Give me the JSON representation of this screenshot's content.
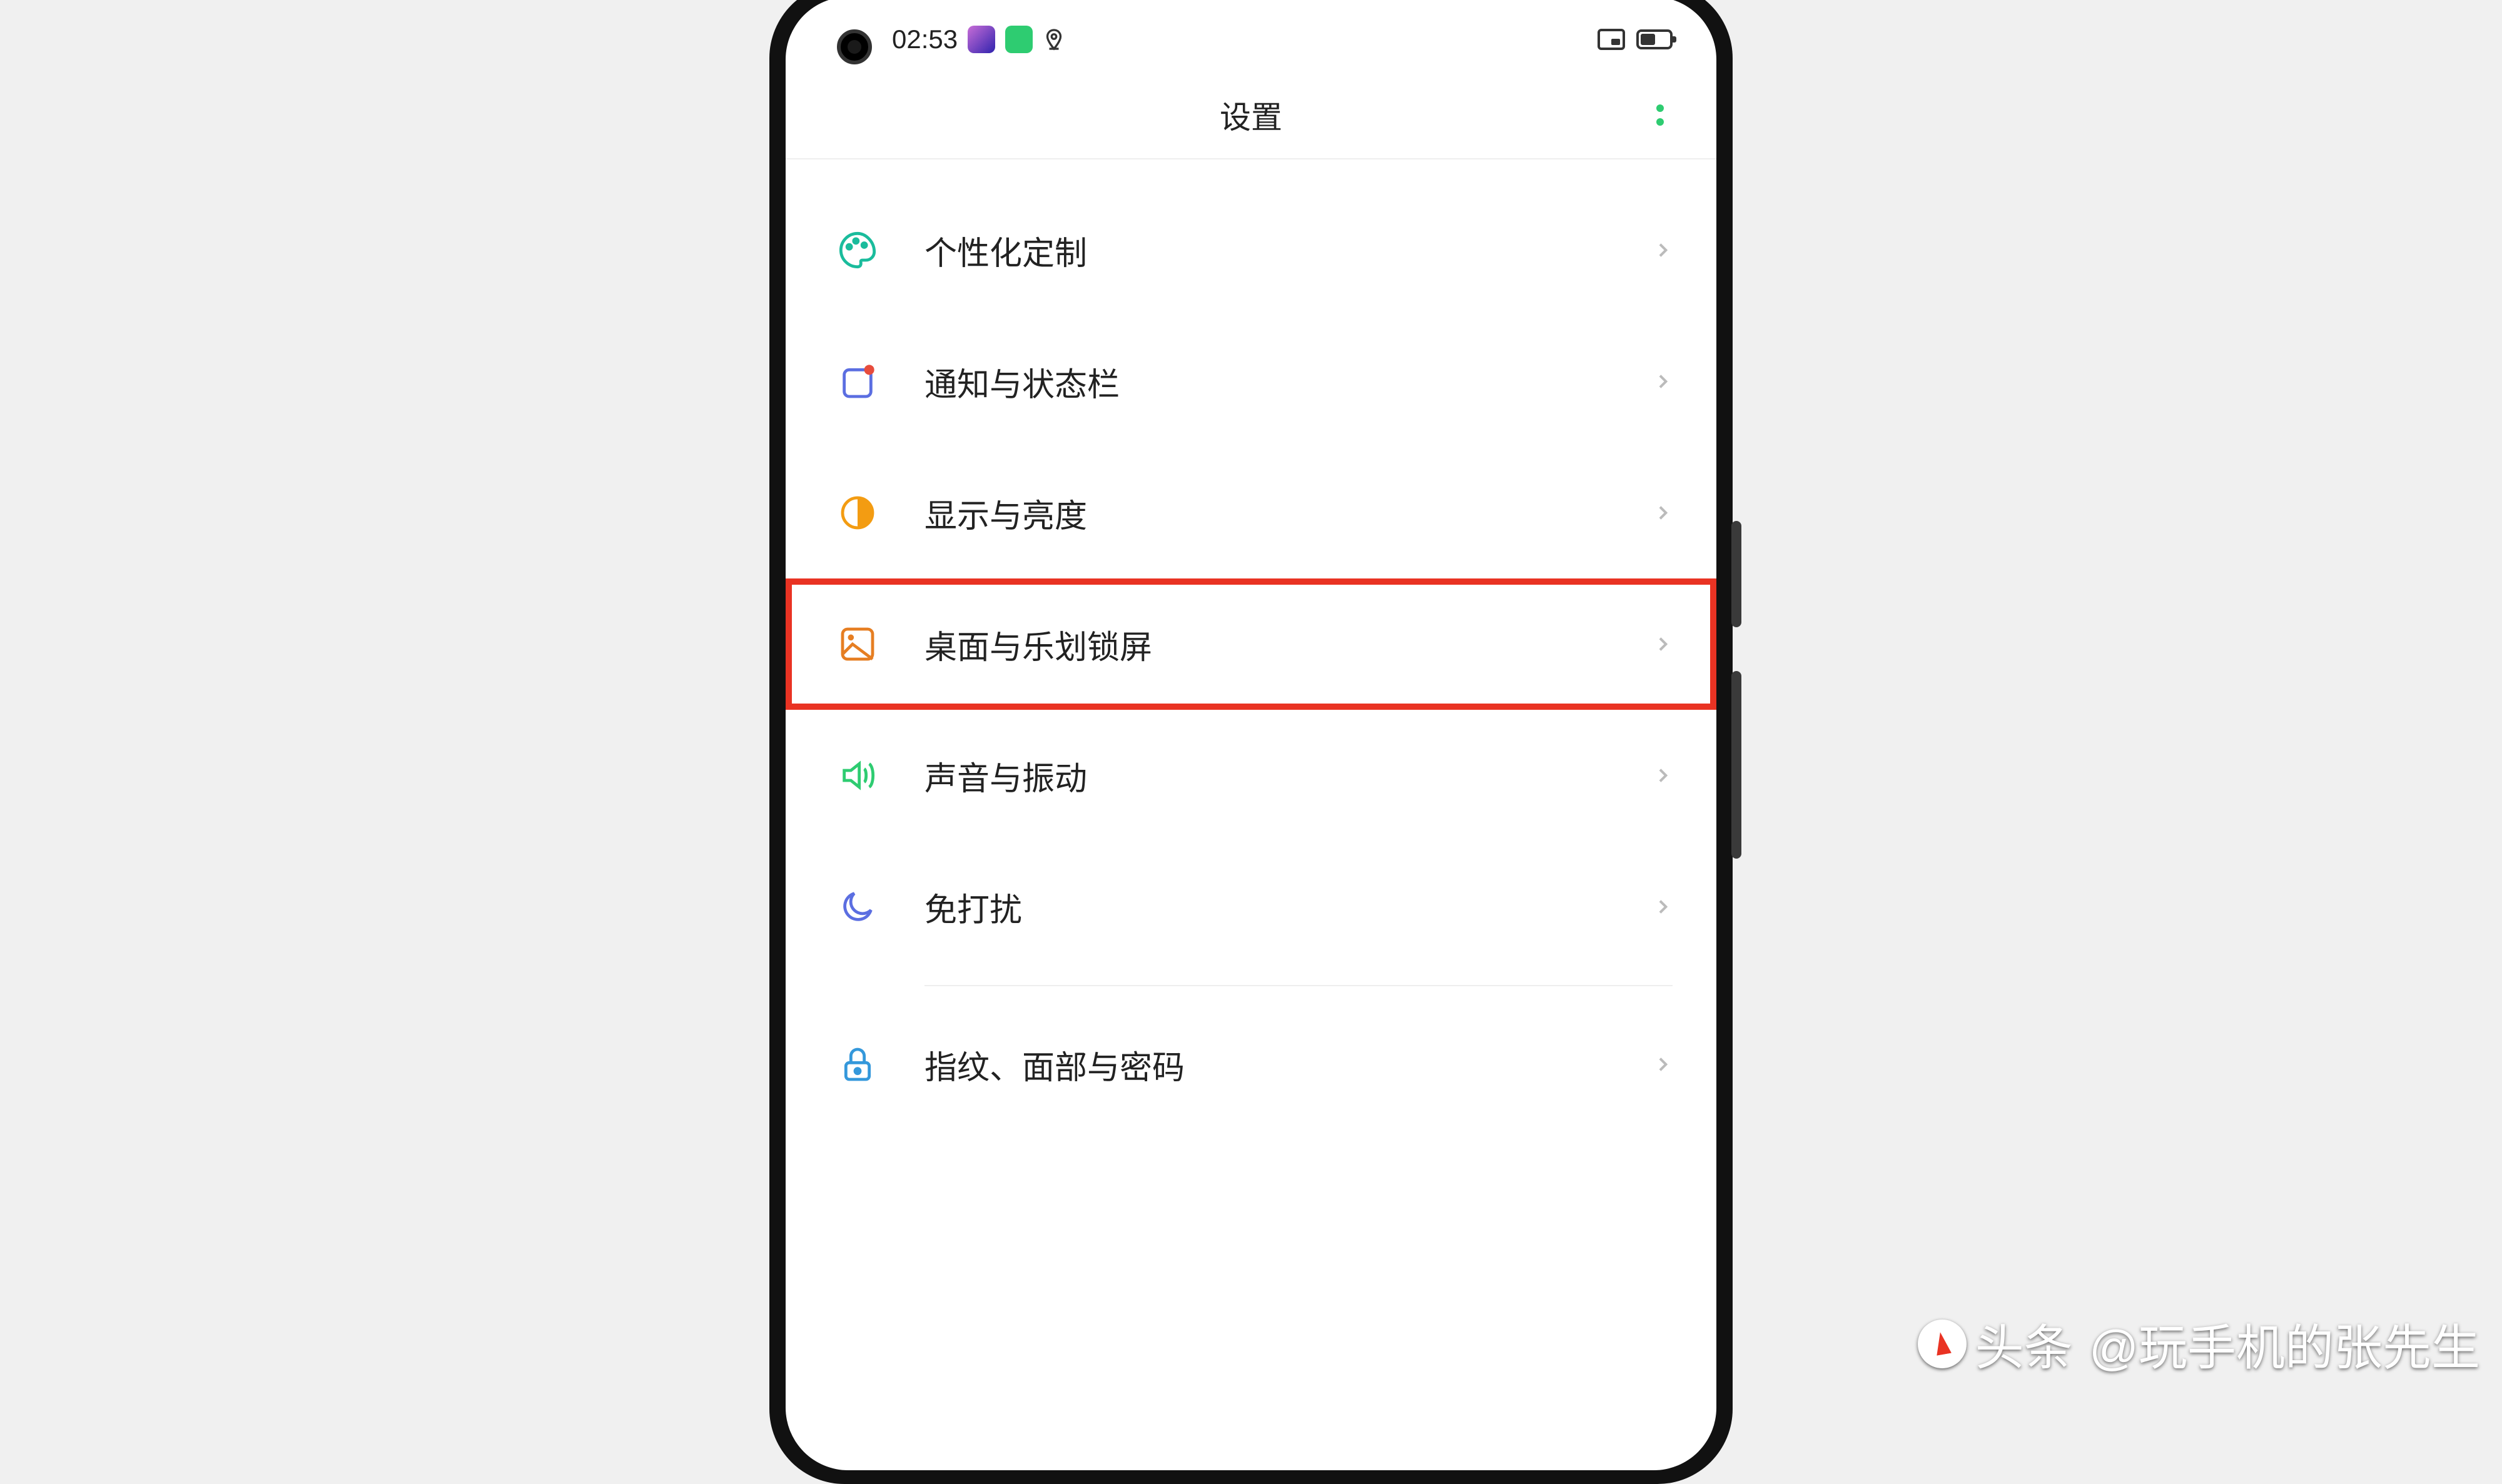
{
  "status_bar": {
    "time": "02:53"
  },
  "header": {
    "title": "设置"
  },
  "settings_items": [
    {
      "label": "个性化定制",
      "highlighted": false
    },
    {
      "label": "通知与状态栏",
      "highlighted": false
    },
    {
      "label": "显示与亮度",
      "highlighted": false
    },
    {
      "label": "桌面与乐划锁屏",
      "highlighted": true
    },
    {
      "label": "声音与振动",
      "highlighted": false
    },
    {
      "label": "免打扰",
      "highlighted": false
    },
    {
      "label": "指纹、面部与密码",
      "highlighted": false
    }
  ],
  "watermark": {
    "brand": "头条",
    "handle": "@玩手机的张先生"
  },
  "colors": {
    "highlight": "#e93323",
    "accent_green": "#2ecc71",
    "icon_teal": "#1abc9c",
    "icon_blue": "#3498db",
    "icon_orange": "#f39c12",
    "icon_red_orange": "#e67e22",
    "icon_purple": "#5b6ee1"
  }
}
